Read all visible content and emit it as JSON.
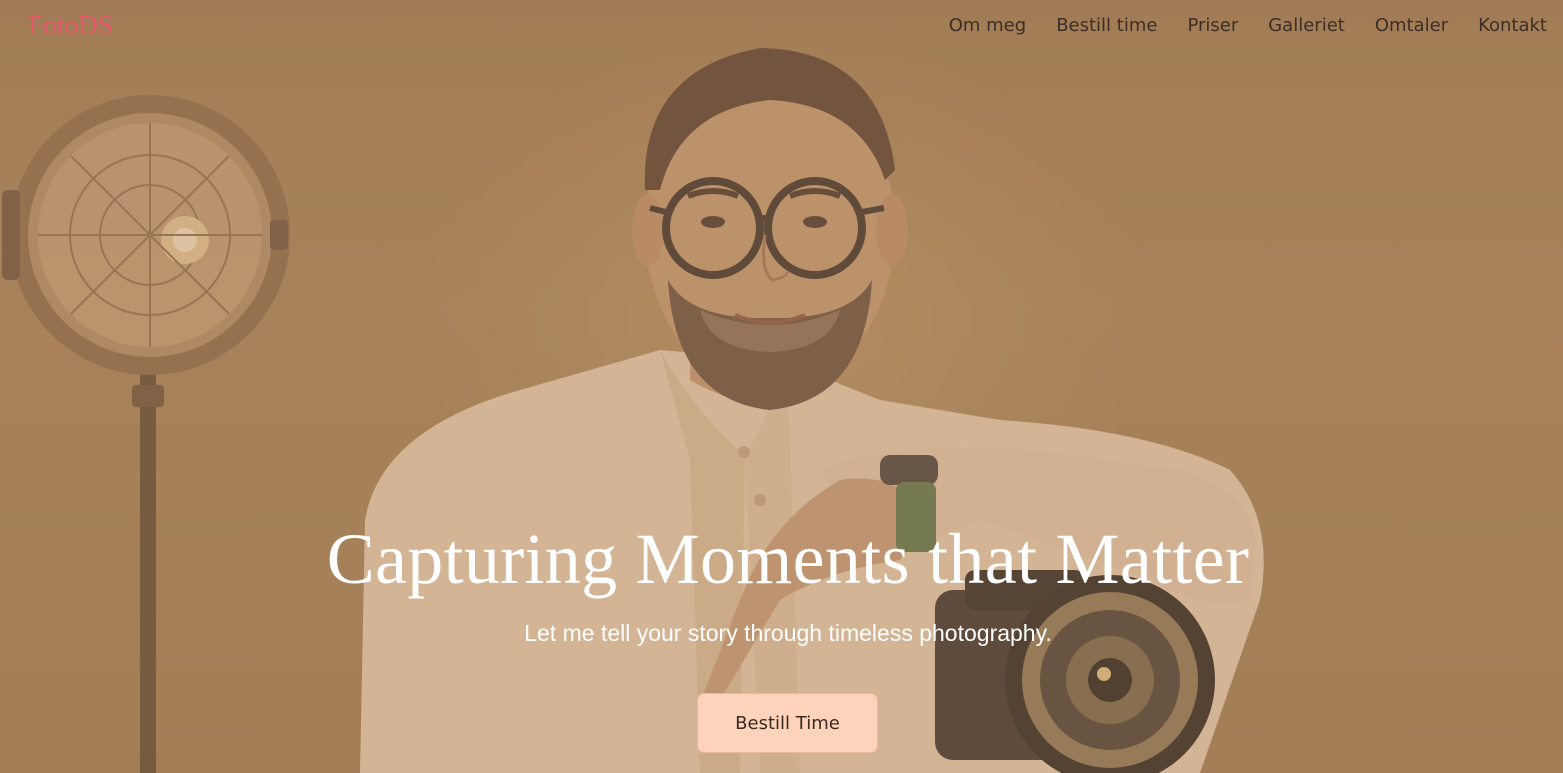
{
  "brand": {
    "name": "FotoDS"
  },
  "nav": {
    "items": [
      {
        "label": "Om meg"
      },
      {
        "label": "Bestill time"
      },
      {
        "label": "Priser"
      },
      {
        "label": "Galleriet"
      },
      {
        "label": "Omtaler"
      },
      {
        "label": "Kontakt"
      }
    ]
  },
  "hero": {
    "headline": "Capturing Moments that Matter",
    "subline": "Let me tell your story through timeless photography.",
    "cta_label": "Bestill Time",
    "image_icon": "photographer-portrait-image"
  },
  "colors": {
    "brand": "#e8566c",
    "nav_text": "#3d2e26",
    "cta_bg": "#fdd3bb",
    "hero_text": "#ffffff",
    "backdrop": "#a7845e"
  }
}
